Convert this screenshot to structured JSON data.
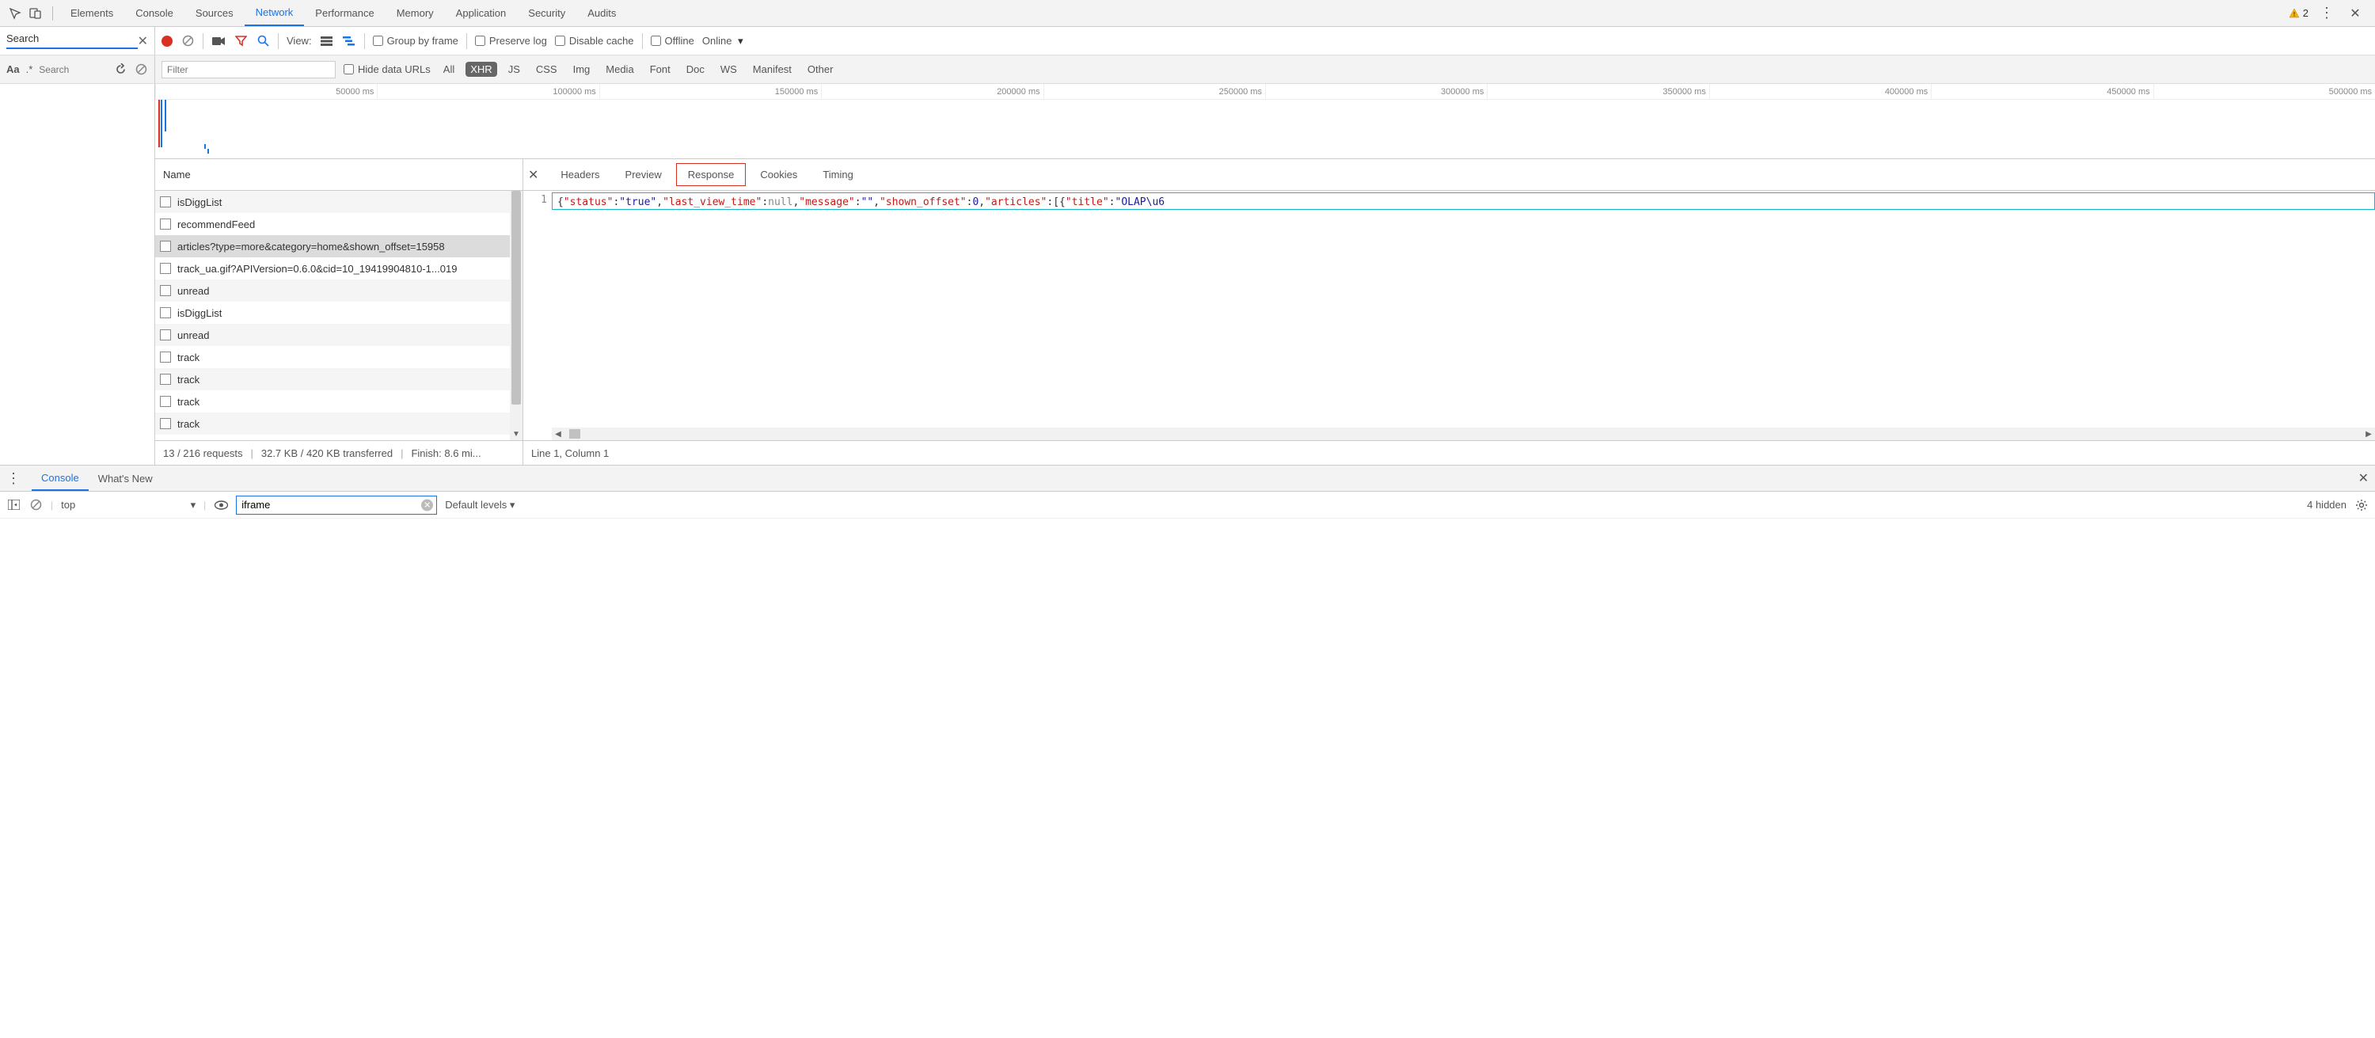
{
  "topTabs": [
    "Elements",
    "Console",
    "Sources",
    "Network",
    "Performance",
    "Memory",
    "Application",
    "Security",
    "Audits"
  ],
  "topActiveTab": "Network",
  "warnings": "2",
  "searchPanel": {
    "label": "Search",
    "placeholder": "Search"
  },
  "networkToolbar": {
    "viewLabel": "View:",
    "groupByFrame": "Group by frame",
    "preserveLog": "Preserve log",
    "disableCache": "Disable cache",
    "offline": "Offline",
    "online": "Online"
  },
  "filterBar": {
    "filterPlaceholder": "Filter",
    "hideDataUrls": "Hide data URLs",
    "types": [
      "All",
      "XHR",
      "JS",
      "CSS",
      "Img",
      "Media",
      "Font",
      "Doc",
      "WS",
      "Manifest",
      "Other"
    ],
    "activeType": "XHR"
  },
  "timelineTicks": [
    "50000 ms",
    "100000 ms",
    "150000 ms",
    "200000 ms",
    "250000 ms",
    "300000 ms",
    "350000 ms",
    "400000 ms",
    "450000 ms",
    "500000 ms"
  ],
  "requests": {
    "header": "Name",
    "rows": [
      {
        "name": "isDiggList",
        "selected": false
      },
      {
        "name": "recommendFeed",
        "selected": false
      },
      {
        "name": "articles?type=more&category=home&shown_offset=15958",
        "selected": true
      },
      {
        "name": "track_ua.gif?APIVersion=0.6.0&cid=10_19419904810-1...019",
        "selected": false
      },
      {
        "name": "unread",
        "selected": false
      },
      {
        "name": "isDiggList",
        "selected": false
      },
      {
        "name": "unread",
        "selected": false
      },
      {
        "name": "track",
        "selected": false
      },
      {
        "name": "track",
        "selected": false
      },
      {
        "name": "track",
        "selected": false
      },
      {
        "name": "track",
        "selected": false
      },
      {
        "name": "track",
        "selected": false
      }
    ]
  },
  "detailTabs": [
    "Headers",
    "Preview",
    "Response",
    "Cookies",
    "Timing"
  ],
  "detailActiveTab": "Response",
  "responseLineNum": "1",
  "responseTokens": [
    {
      "t": "brace",
      "v": "{"
    },
    {
      "t": "key",
      "v": "\"status\""
    },
    {
      "t": "brace",
      "v": ":"
    },
    {
      "t": "str",
      "v": "\"true\""
    },
    {
      "t": "brace",
      "v": ","
    },
    {
      "t": "key",
      "v": "\"last_view_time\""
    },
    {
      "t": "brace",
      "v": ":"
    },
    {
      "t": "null",
      "v": "null"
    },
    {
      "t": "brace",
      "v": ","
    },
    {
      "t": "key",
      "v": "\"message\""
    },
    {
      "t": "brace",
      "v": ":"
    },
    {
      "t": "str",
      "v": "\"\""
    },
    {
      "t": "brace",
      "v": ","
    },
    {
      "t": "key",
      "v": "\"shown_offset\""
    },
    {
      "t": "brace",
      "v": ":"
    },
    {
      "t": "num",
      "v": "0"
    },
    {
      "t": "brace",
      "v": ","
    },
    {
      "t": "key",
      "v": "\"articles\""
    },
    {
      "t": "brace",
      "v": ":[{"
    },
    {
      "t": "key",
      "v": "\"title\""
    },
    {
      "t": "brace",
      "v": ":"
    },
    {
      "t": "str",
      "v": "\"OLAP\\u6"
    }
  ],
  "statusBar": {
    "requests": "13 / 216 requests",
    "transferred": "32.7 KB / 420 KB transferred",
    "finish": "Finish: 8.6 mi...",
    "cursor": "Line 1, Column 1"
  },
  "drawer": {
    "tabs": [
      "Console",
      "What's New"
    ],
    "activeTab": "Console",
    "context": "top",
    "filterValue": "iframe",
    "levels": "Default levels",
    "hidden": "4 hidden"
  }
}
